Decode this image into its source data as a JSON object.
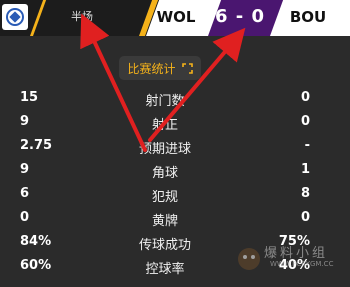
{
  "header": {
    "half_label": "半场",
    "home_team": "WOL",
    "score": "6 - 0",
    "away_team": "BOU"
  },
  "stats_title": "比赛统计",
  "stats": [
    {
      "label": "射门数",
      "home": "15",
      "away": "0"
    },
    {
      "label": "射正",
      "home": "9",
      "away": "0"
    },
    {
      "label": "预期进球",
      "home": "2.75",
      "away": "-"
    },
    {
      "label": "角球",
      "home": "9",
      "away": "1"
    },
    {
      "label": "犯规",
      "home": "6",
      "away": "8"
    },
    {
      "label": "黄牌",
      "home": "0",
      "away": "0"
    },
    {
      "label": "传球成功",
      "home": "84%",
      "away": "75%"
    },
    {
      "label": "控球率",
      "home": "60%",
      "away": "40%"
    }
  ],
  "watermark": {
    "text": "爆料小组",
    "url": "WWW.PCRYGM.CC"
  },
  "colors": {
    "accent": "#f5b21a",
    "score_bg": "#4a1670",
    "arrow": "#e02020",
    "background": "#2b2b2b"
  }
}
